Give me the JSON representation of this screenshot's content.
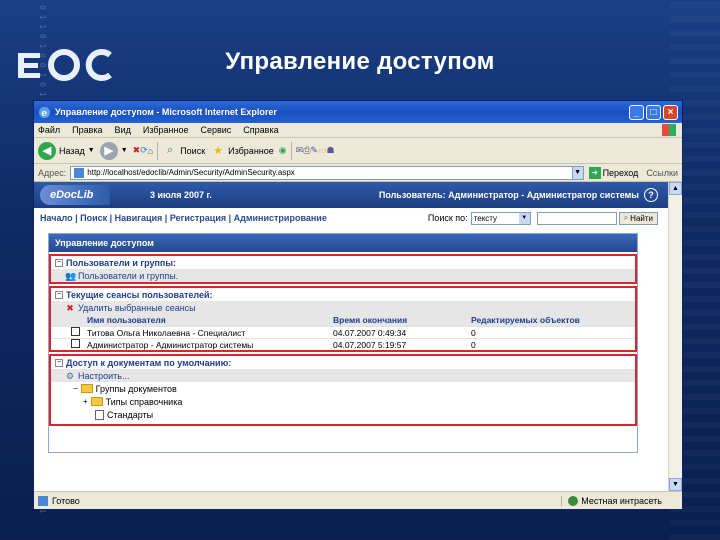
{
  "slide": {
    "title": "Управление доступом"
  },
  "browser": {
    "title": "Управление доступом - Microsoft Internet Explorer",
    "menu": [
      "Файл",
      "Правка",
      "Вид",
      "Избранное",
      "Сервис",
      "Справка"
    ],
    "toolbar": {
      "back": "Назад",
      "search": "Поиск",
      "favorites": "Избранное"
    },
    "address_label": "Адрес:",
    "address": "http://localhost/edoclib/Admin/Security/AdminSecurity.aspx",
    "go": "Переход",
    "links": "Ссылки",
    "status": "Готово",
    "zone": "Местная интрасеть"
  },
  "app": {
    "logo": "eDocLib",
    "date": "3 июля 2007 г.",
    "user": "Пользователь: Администратор - Администратор системы",
    "nav": "Начало | Поиск | Навигация | Регистрация | Администрирование",
    "search_label": "Поиск по:",
    "search_option": "тексту",
    "search_button": "Найти"
  },
  "panel": {
    "title": "Управление доступом",
    "users": {
      "title": "Пользователи и группы:",
      "link": "Пользователи и группы."
    },
    "sessions": {
      "title": "Текущие сеансы пользователей:",
      "action": "Удалить выбранные сеансы",
      "columns": [
        "Имя пользователя",
        "Время окончания",
        "Редактируемых объектов"
      ],
      "rows": [
        [
          "Титова Ольга Николаевна - Специалист",
          "04.07.2007 0:49:34",
          "0"
        ],
        [
          "Администратор - Администратор системы",
          "04.07.2007 5:19:57",
          "0"
        ]
      ]
    },
    "access": {
      "title": "Доступ к документам по умолчанию:",
      "configure": "Настроить...",
      "tree": [
        "Группы документов",
        "Типы справочника",
        "Стандарты"
      ]
    }
  }
}
